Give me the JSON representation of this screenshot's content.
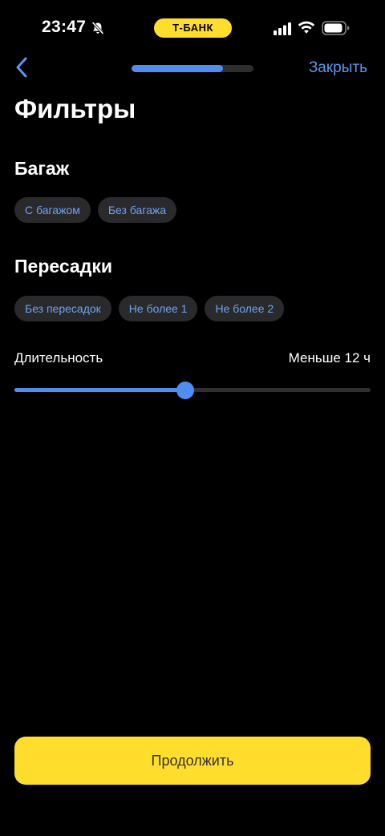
{
  "status_bar": {
    "time": "23:47",
    "carrier_label": "Т-БАНК"
  },
  "nav": {
    "close_label": "Закрыть",
    "progress_fraction": 0.75
  },
  "page": {
    "title": "Фильтры"
  },
  "baggage": {
    "heading": "Багаж",
    "options": [
      "С багажом",
      "Без багажа"
    ]
  },
  "transfers": {
    "heading": "Пересадки",
    "options": [
      "Без пересадок",
      "Не более 1",
      "Не более 2"
    ]
  },
  "duration": {
    "label": "Длительность",
    "value": "Меньше 12 ч",
    "slider_fraction": 0.48
  },
  "footer": {
    "continue_label": "Продолжить"
  },
  "colors": {
    "accent": "#4e8ef3",
    "brand_yellow": "#ffdd2d",
    "chip_background": "#2a2a2c",
    "chip_text": "#6ea3f2"
  }
}
